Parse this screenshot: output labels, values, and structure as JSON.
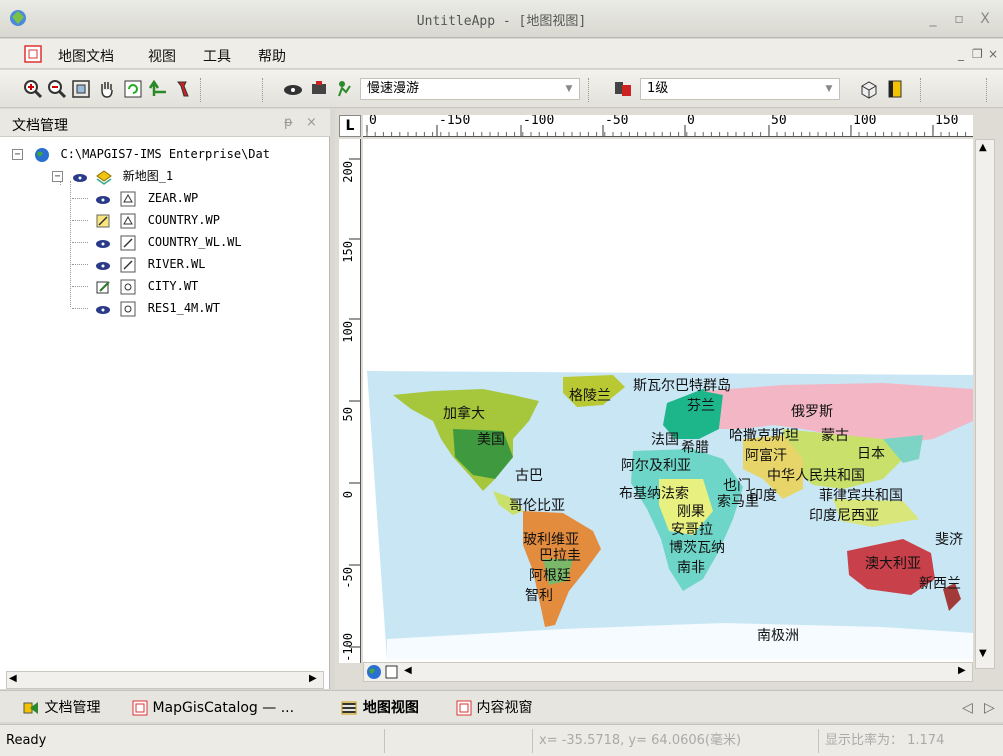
{
  "window": {
    "title": "UntitleApp - [地图视图]",
    "minimize": "_",
    "maximize": "▫",
    "close": "X"
  },
  "menu": {
    "items": [
      "地图文档",
      "视图",
      "工具",
      "帮助"
    ],
    "mdi_min": "_",
    "mdi_restore": "❐",
    "mdi_close": "×"
  },
  "toolbar": {
    "roam_mode": "慢速漫游",
    "level": "1级"
  },
  "left_pane": {
    "title": "文档管理",
    "pin": "ᵽ",
    "close": "×",
    "root": "C:\\MAPGIS7-IMS Enterprise\\Dat",
    "map_name": "新地图_1",
    "layers": [
      {
        "name": "ZEAR.WP",
        "icon": "eye-icon"
      },
      {
        "name": "COUNTRY.WP",
        "icon": "edit-icon"
      },
      {
        "name": "COUNTRY_WL.WL",
        "icon": "eye-icon"
      },
      {
        "name": "RIVER.WL",
        "icon": "eye-icon"
      },
      {
        "name": "CITY.WT",
        "icon": "edit-icon"
      },
      {
        "name": "RES1_4M.WT",
        "icon": "eye-icon"
      }
    ]
  },
  "ruler": {
    "corner": "L",
    "top_ticks": [
      "0",
      "-150",
      "-100",
      "-50",
      "0",
      "50",
      "100",
      "150"
    ],
    "left_ticks": [
      "200",
      "150",
      "100",
      "50",
      "0",
      "-50",
      "-100"
    ]
  },
  "map_labels": [
    "斯瓦尔巴特群岛",
    "格陵兰",
    "芬兰",
    "加拿大",
    "俄罗斯",
    "美国",
    "法国",
    "哈撒克斯坦",
    "蒙古",
    "希腊",
    "阿富汗",
    "日本",
    "阿尔及利亚",
    "古巴",
    "中华人民共和国",
    "也门",
    "布基纳法索",
    "印度",
    "菲律宾共和国",
    "索马里",
    "哥伦比亚",
    "刚果",
    "印度尼西亚",
    "安哥拉",
    "玻利维亚",
    "斐济",
    "博茨瓦纳",
    "巴拉圭",
    "澳大利亚",
    "南非",
    "阿根廷",
    "新西兰",
    "智利",
    "南极洲"
  ],
  "tabs": {
    "left": [
      "文档管理",
      "MapGisCatalog — ..."
    ],
    "right": [
      "地图视图",
      "内容视窗"
    ],
    "nav_prev": "◁",
    "nav_next": "▷"
  },
  "status": {
    "ready": "Ready",
    "coords": "x= -35.5718, y= 64.0606(毫米)",
    "scale": "显示比率为： 1.174"
  }
}
